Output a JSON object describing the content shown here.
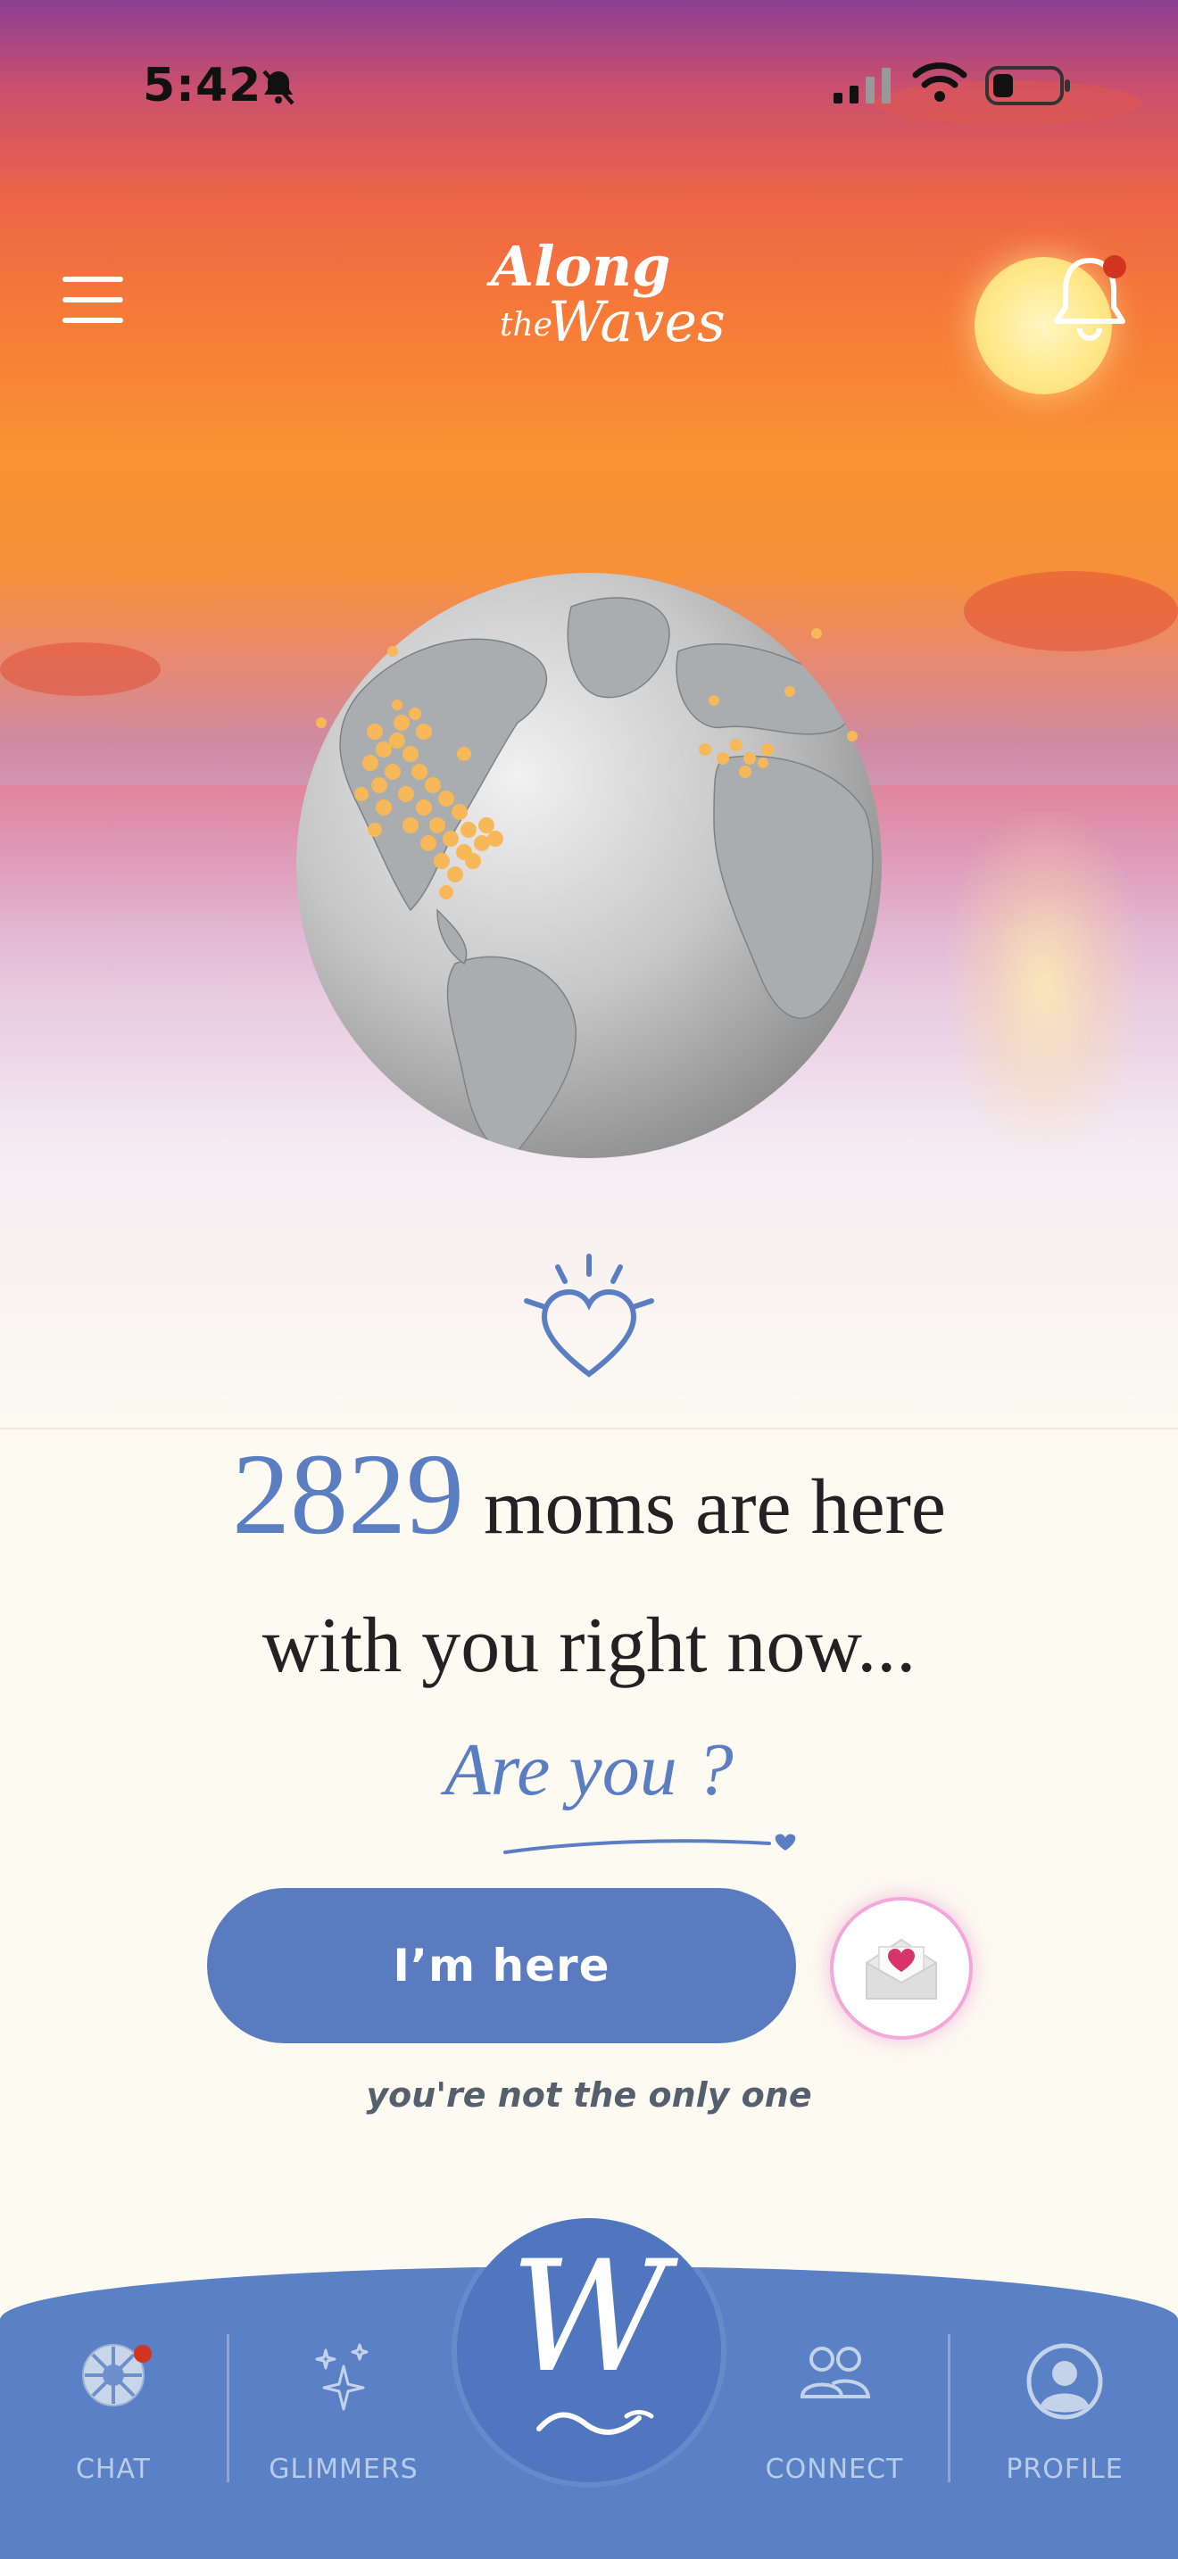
{
  "status_bar": {
    "time": "5:42",
    "icons": [
      "bell-slash-icon",
      "cellular-signal-icon",
      "wifi-icon",
      "battery-low-icon"
    ]
  },
  "header": {
    "logo_line1": "Along",
    "logo_line2": "the",
    "logo_line3": "Waves",
    "menu_icon": "hamburger-icon",
    "notification_icon": "bell-icon",
    "has_notification": true
  },
  "main": {
    "globe_icon": "globe-icon",
    "heart_icon": "glowing-heart-icon",
    "count": "2829",
    "headline_rest": "moms are here",
    "headline_line2": "with you right now...",
    "question": "Are you ?",
    "cta_label": "I’m here",
    "envelope_icon": "heart-envelope-icon",
    "subtext": "you're not the only one"
  },
  "bottom_nav": {
    "items": [
      {
        "label": "CHAT",
        "icon": "chat-wheel-icon",
        "badge": true
      },
      {
        "label": "GLIMMERS",
        "icon": "sparkles-icon"
      },
      {
        "label": "CONNECT",
        "icon": "people-icon"
      },
      {
        "label": "PROFILE",
        "icon": "user-circle-icon"
      }
    ],
    "center_label": "W",
    "center_icon": "waves-logo-icon"
  },
  "colors": {
    "accent": "#5b7dc2",
    "nav_background": "#5a80c6",
    "notification": "#d2351f"
  }
}
